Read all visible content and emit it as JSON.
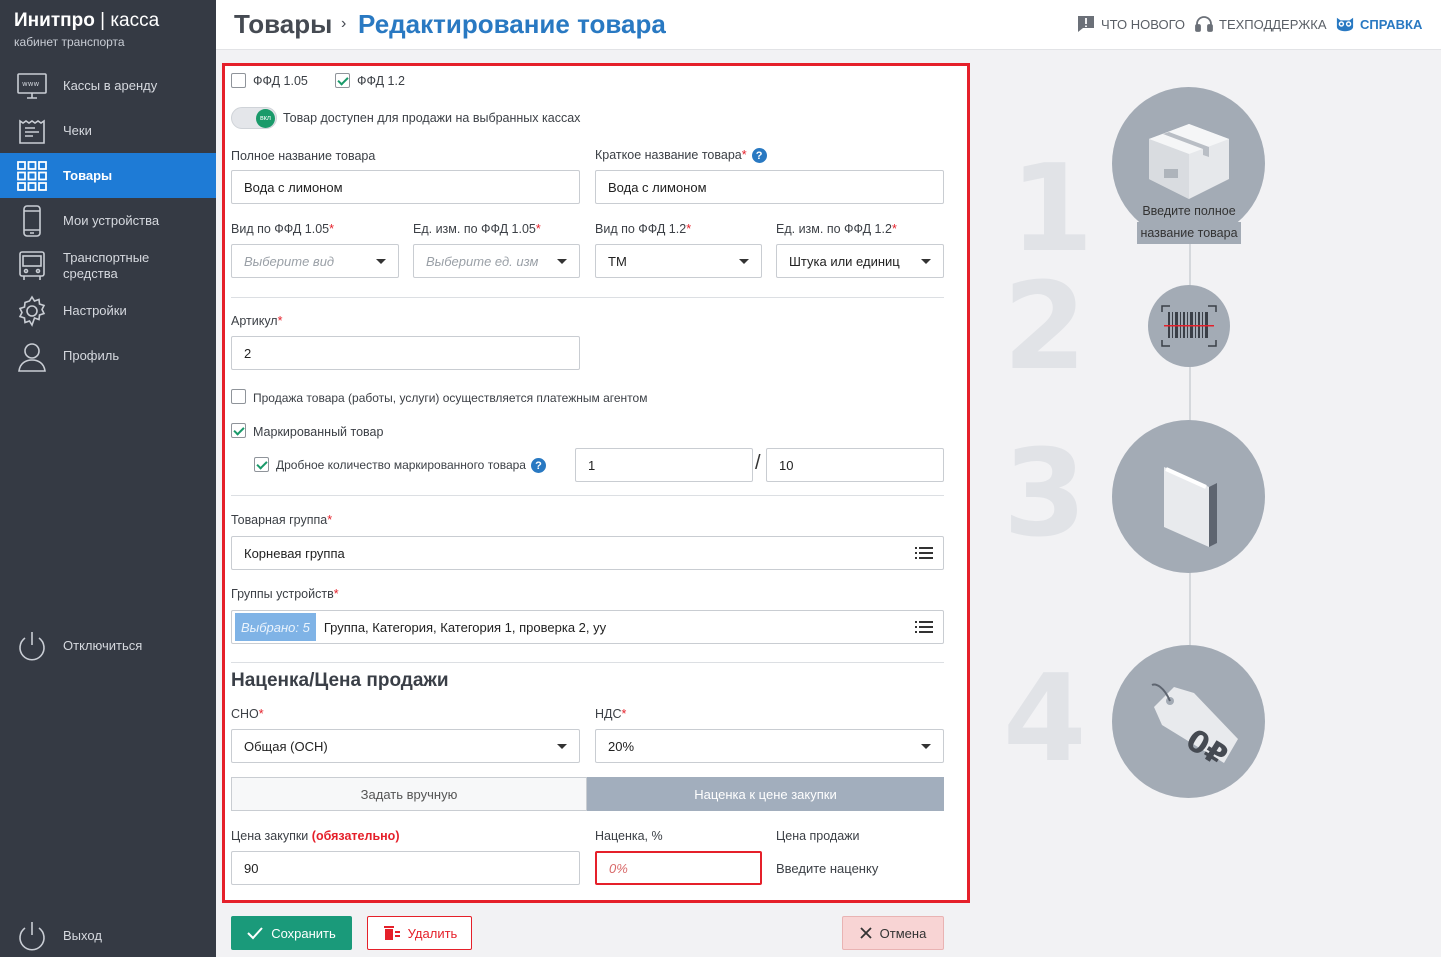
{
  "app": {
    "brand_main": "Инитпро",
    "brand_sep": "|",
    "brand_sub": "касса",
    "tagline": "кабинет транспорта"
  },
  "sidebar": {
    "items": [
      {
        "label": "Кассы в аренду",
        "icon": "monitor-www-icon"
      },
      {
        "label": "Чеки",
        "icon": "receipt-icon"
      },
      {
        "label": "Товары",
        "icon": "grid-icon",
        "active": true
      },
      {
        "label": "Мои устройства",
        "icon": "phone-icon"
      },
      {
        "label": "Транспортные средства",
        "icon": "bus-icon"
      },
      {
        "label": "Настройки",
        "icon": "gear-icon"
      },
      {
        "label": "Профиль",
        "icon": "user-icon"
      }
    ],
    "disconnect": "Отключиться",
    "logout": "Выход"
  },
  "header": {
    "crumb_root": "Товары",
    "crumb_arrow": "›",
    "crumb_current": "Редактирование товара",
    "links": {
      "whats_new": "ЧТО НОВОГО",
      "support": "ТЕХПОДДЕРЖКА",
      "help": "СПРАВКА"
    }
  },
  "form": {
    "ffd105": "ФФД 1.05",
    "ffd12": "ФФД 1.2",
    "toggle_badge": "вкл",
    "toggle_label": "Товар доступен для продажи на выбранных кассах",
    "full_name_label": "Полное название товара",
    "full_name_value": "Вода с лимоном",
    "short_name_label": "Краткое название товара",
    "short_name_value": "Вода с лимоном",
    "asterisk": "*",
    "help_mark": "?",
    "kind105_label": "Вид по ФФД 1.05",
    "kind105_placeholder": "Выберите вид",
    "unit105_label": "Ед. изм. по ФФД 1.05",
    "unit105_placeholder": "Выберите ед. изм",
    "kind12_label": "Вид по ФФД 1.2",
    "kind12_value": "ТМ",
    "unit12_label": "Ед. изм. по ФФД 1.2",
    "unit12_value": "Штука или единиц",
    "article_label": "Артикул",
    "article_value": "2",
    "agent_label": "Продажа товара (работы, услуги) осуществляется платежным агентом",
    "marked_label": "Маркированный товар",
    "fraction_label": "Дробное количество маркированного товара",
    "fraction_num": "1",
    "fraction_sep": "/",
    "fraction_den": "10",
    "group_label": "Товарная группа",
    "group_value": "Корневая группа",
    "devgroups_label": "Группы устройств",
    "devgroups_badge": "Выбрано: 5",
    "devgroups_value": "Группа, Категория, Категория 1, проверка 2, уу",
    "markup_title": "Наценка/Цена продажи",
    "sno_label": "СНО",
    "sno_value": "Общая (ОСН)",
    "vat_label": "НДС",
    "vat_value": "20%",
    "mode_manual": "Задать вручную",
    "mode_markup": "Наценка к цене закупки",
    "purchase_label": "Цена закупки",
    "purchase_required": "(обязательно)",
    "purchase_value": "90",
    "markup_label": "Наценка, %",
    "markup_placeholder": "0%",
    "sale_label": "Цена продажи",
    "sale_hint": "Введите наценку"
  },
  "buttons": {
    "save": "Сохранить",
    "delete": "Удалить",
    "cancel": "Отмена"
  },
  "steps": {
    "nums": [
      "1",
      "2",
      "3",
      "4"
    ],
    "tip_line1": "Введите полное",
    "tip_line2": "название товара"
  },
  "colors": {
    "accent": "#2979c2",
    "sidebar": "#353a44",
    "active": "#1e7bd6",
    "save": "#1a9a7a",
    "danger": "#e5202a"
  }
}
